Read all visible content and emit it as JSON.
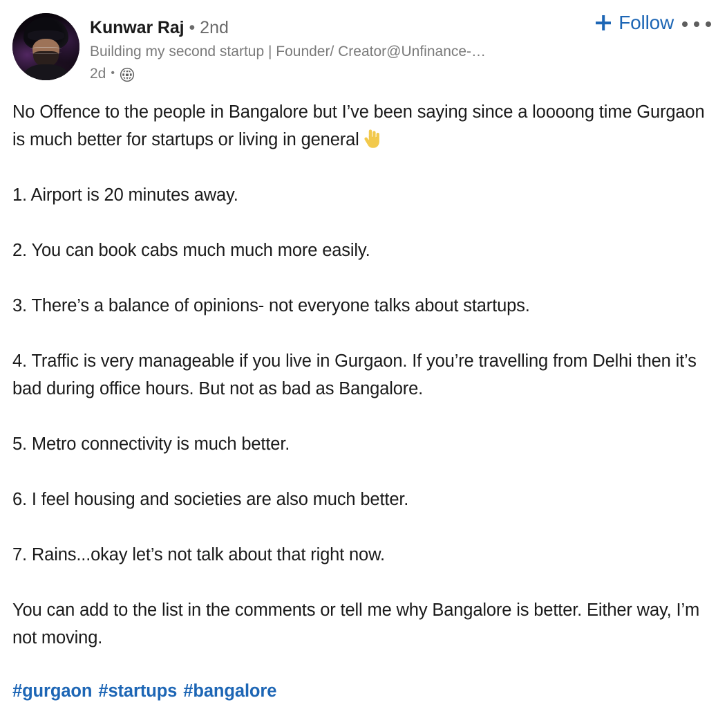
{
  "post": {
    "author": {
      "name": "Kunwar Raj",
      "degree": "• 2nd",
      "headline": "Building my second startup | Founder/ Creator@Unfinance-…",
      "time": "2d",
      "meta_separator": "•",
      "visibility_icon": "globe-icon",
      "avatar_alt": "profile-photo"
    },
    "actions": {
      "follow_label": "Follow",
      "follow_icon": "plus-icon",
      "more_icon": "ellipsis-icon"
    },
    "content": {
      "paragraphs": [
        "No Offence to the people in Bangalore but I’ve been saying since a loooong time Gurgaon is much better for startups or living in general",
        "1. Airport is 20 minutes away.",
        "2. You can book cabs much much more easily.",
        "3. There’s a balance of opinions- not everyone talks about startups.",
        "4. Traffic is very manageable if you live in Gurgaon. If you’re travelling from Delhi then it’s bad during office hours. But not as bad as Bangalore.",
        "5. Metro connectivity is much better.",
        "6. I feel housing and societies are also much better.",
        "7. Rains...okay let’s not talk about that right now.",
        "You can add to the list in the comments or tell me why Bangalore is better. Either way, I’m not moving."
      ],
      "inline_emoji": "point-down-emoji"
    },
    "hashtags": [
      "#gurgaon",
      "#startups",
      "#bangalore"
    ]
  },
  "colors": {
    "link_blue": "#1d66b5",
    "body_text": "#1a1a1a",
    "muted_text": "#7a7a7a",
    "background": "#ffffff",
    "emoji_yellow": "#f2c94c"
  }
}
